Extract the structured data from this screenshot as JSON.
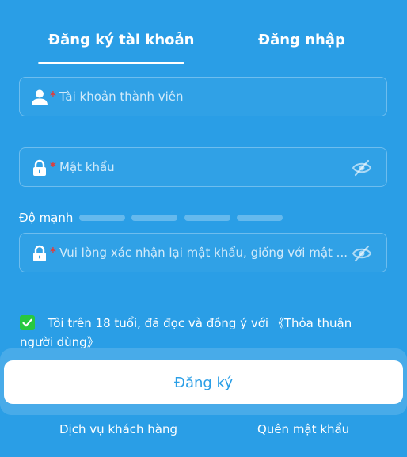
{
  "tabs": {
    "register": "Đăng ký tài khoản",
    "login": "Đăng nhập",
    "active": "register"
  },
  "form": {
    "username_placeholder": "Tài khoản thành viên",
    "password_placeholder": "Mật khẩu",
    "strength_label": "Độ mạnh",
    "confirm_placeholder": "Vui lòng xác nhận lại mật khẩu, giống với mật ...",
    "required_mark": "*"
  },
  "agreement": {
    "checked": true,
    "text": "Tôi trên 18 tuổi, đã đọc và đồng ý với 《Thỏa thuận người dùng》"
  },
  "submit_label": "Đăng ký",
  "footer": {
    "support": "Dịch vụ khách hàng",
    "forgot": "Quên mật khẩu"
  },
  "colors": {
    "background": "#2a9ee6",
    "required": "#e53935",
    "checkbox": "#28c840"
  },
  "icons": {
    "username": "user-icon",
    "password": "lock-icon",
    "reveal": "eye-slash-icon"
  }
}
